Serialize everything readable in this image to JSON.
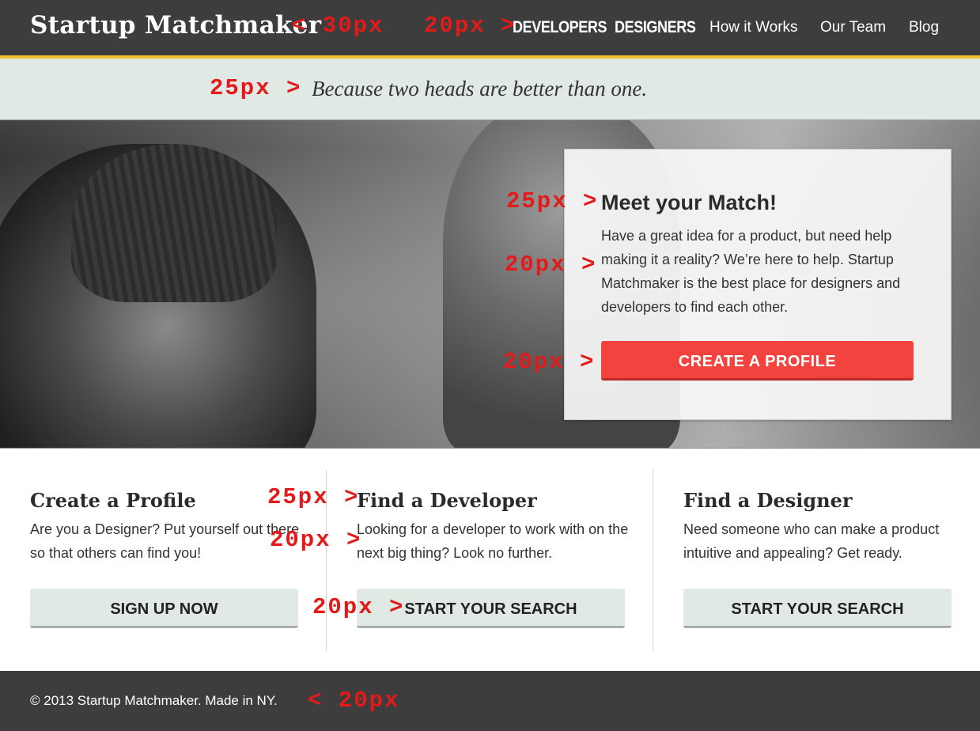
{
  "header": {
    "logo": "Startup Matchmaker",
    "nav": [
      {
        "label": "DEVELOPERS",
        "bold": true
      },
      {
        "label": "DESIGNERS",
        "bold": true
      },
      {
        "label": "How it Works",
        "bold": false
      },
      {
        "label": "Our Team",
        "bold": false
      },
      {
        "label": "Blog",
        "bold": false
      }
    ]
  },
  "tagline": "Because two heads are better than one.",
  "hero": {
    "title": "Meet your Match!",
    "body": "Have a great idea for a product, but need help making it a reality? We’re here to help. Startup Matchmaker is the best place for designers and developers to find each other.",
    "cta": "CREATE A PROFILE"
  },
  "columns": [
    {
      "title": "Create a Profile",
      "body": "Are you a Designer? Put yourself out there so that others can find you!",
      "button": "SIGN UP NOW"
    },
    {
      "title": "Find a Developer",
      "body": "Looking for a developer to work with on the next big thing? Look no further.",
      "button": "START YOUR SEARCH"
    },
    {
      "title": "Find a Designer",
      "body": "Need someone who can make a product intuitive and appealing? Get ready.",
      "button": "START YOUR SEARCH"
    }
  ],
  "footer": "© 2013 Startup Matchmaker. Made in NY.",
  "annotations": {
    "logo_spacing": "< 30px",
    "nav_spacing": "20px >",
    "tagline_spacing": "25px >",
    "hero_title_spacing": "25px >",
    "hero_body_spacing": "20px >",
    "hero_cta_spacing": "20px >",
    "col_title_spacing": "25px >",
    "col_body_spacing": "20px >",
    "col_btn_spacing": "20px >",
    "footer_spacing": "< 20px"
  },
  "colors": {
    "header_bg": "#3d3d3d",
    "accent_yellow": "#f2c230",
    "tagline_bg": "#e0e9e4",
    "cta_red": "#f2433f",
    "annotation_red": "#e21a1a"
  }
}
